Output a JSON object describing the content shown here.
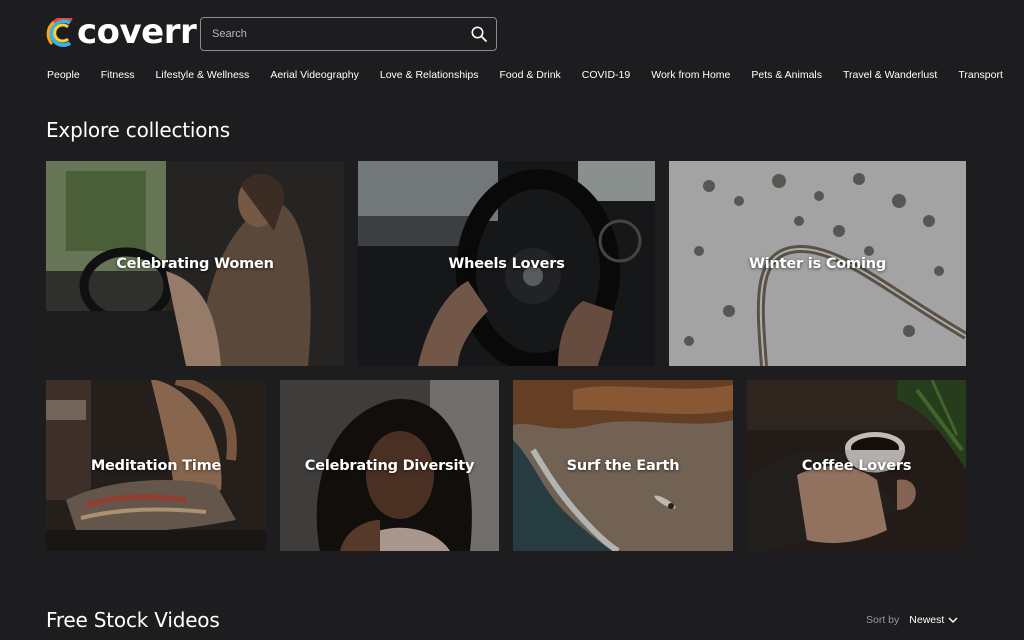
{
  "brand": {
    "name": "coverr",
    "colors": [
      "#f5a623",
      "#e8463b",
      "#3fb0e8",
      "#f6d431"
    ]
  },
  "search": {
    "placeholder": "Search"
  },
  "categories": [
    "People",
    "Fitness",
    "Lifestyle & Wellness",
    "Aerial Videography",
    "Love & Relationships",
    "Food & Drink",
    "COVID-19",
    "Work from Home",
    "Pets & Animals",
    "Travel & Wanderlust",
    "Transport"
  ],
  "collections_title": "Explore collections",
  "collections": [
    {
      "label": "Celebrating Women",
      "image": "woman-in-car"
    },
    {
      "label": "Wheels Lovers",
      "image": "steering-wheel"
    },
    {
      "label": "Winter is Coming",
      "image": "snowy-road"
    },
    {
      "label": "Meditation Time",
      "image": "meditating-person"
    },
    {
      "label": "Celebrating Diversity",
      "image": "portrait-woman"
    },
    {
      "label": "Surf the Earth",
      "image": "beach-surfer"
    },
    {
      "label": "Coffee Lovers",
      "image": "coffee-cup"
    }
  ],
  "videos_title": "Free Stock Videos",
  "sort": {
    "label": "Sort by",
    "value": "Newest"
  }
}
